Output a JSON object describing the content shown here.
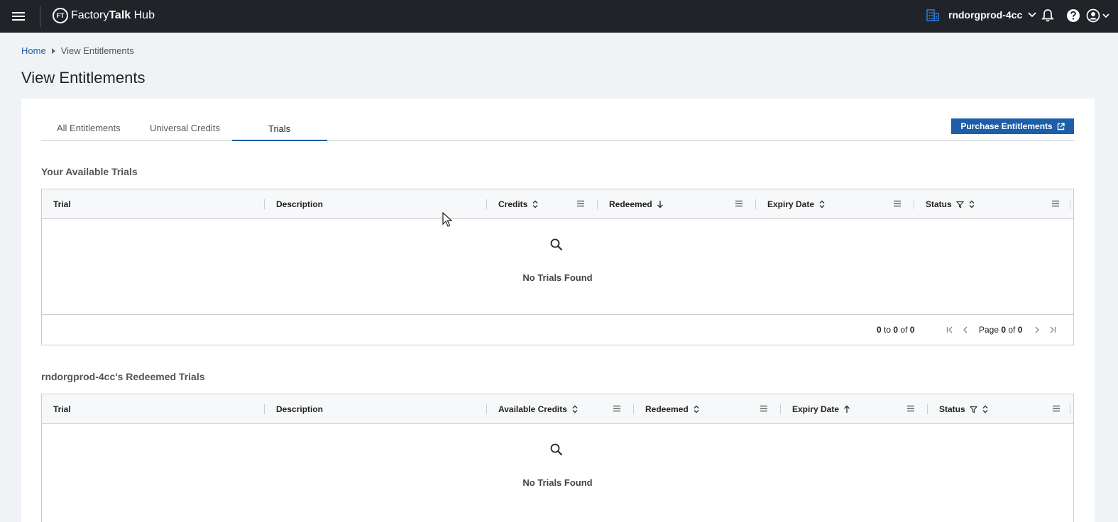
{
  "app": {
    "brand_prefix": "Factory",
    "brand_bold": "Talk",
    "brand_suffix": " Hub",
    "logo_text": "FT"
  },
  "header": {
    "org_name": "rndorgprod-4cc"
  },
  "breadcrumb": {
    "home": "Home",
    "current": "View Entitlements"
  },
  "page": {
    "title": "View Entitlements"
  },
  "tabs": [
    {
      "label": "All Entitlements"
    },
    {
      "label": "Universal Credits"
    },
    {
      "label": "Trials",
      "active": true
    }
  ],
  "purchase_button": {
    "label": "Purchase Entitlements"
  },
  "available_trials": {
    "title": "Your Available Trials",
    "columns": [
      "Trial",
      "Description",
      "Credits",
      "Redeemed",
      "Expiry Date",
      "Status"
    ],
    "empty_text": "No Trials Found",
    "row_count": {
      "from": "0",
      "to": "0",
      "of": "0",
      "to_label": " to ",
      "of_label": " of "
    },
    "page": {
      "label": "Page ",
      "current": "0",
      "of_label": " of ",
      "total": "0"
    }
  },
  "redeemed_trials": {
    "title": "rndorgprod-4cc's Redeemed Trials",
    "columns": [
      "Trial",
      "Description",
      "Available Credits",
      "Redeemed",
      "Expiry Date",
      "Status"
    ],
    "empty_text": "No Trials Found"
  },
  "colors": {
    "topbar": "#202428",
    "accent": "#1c5ea8",
    "org_icon": "#2f74d0"
  }
}
